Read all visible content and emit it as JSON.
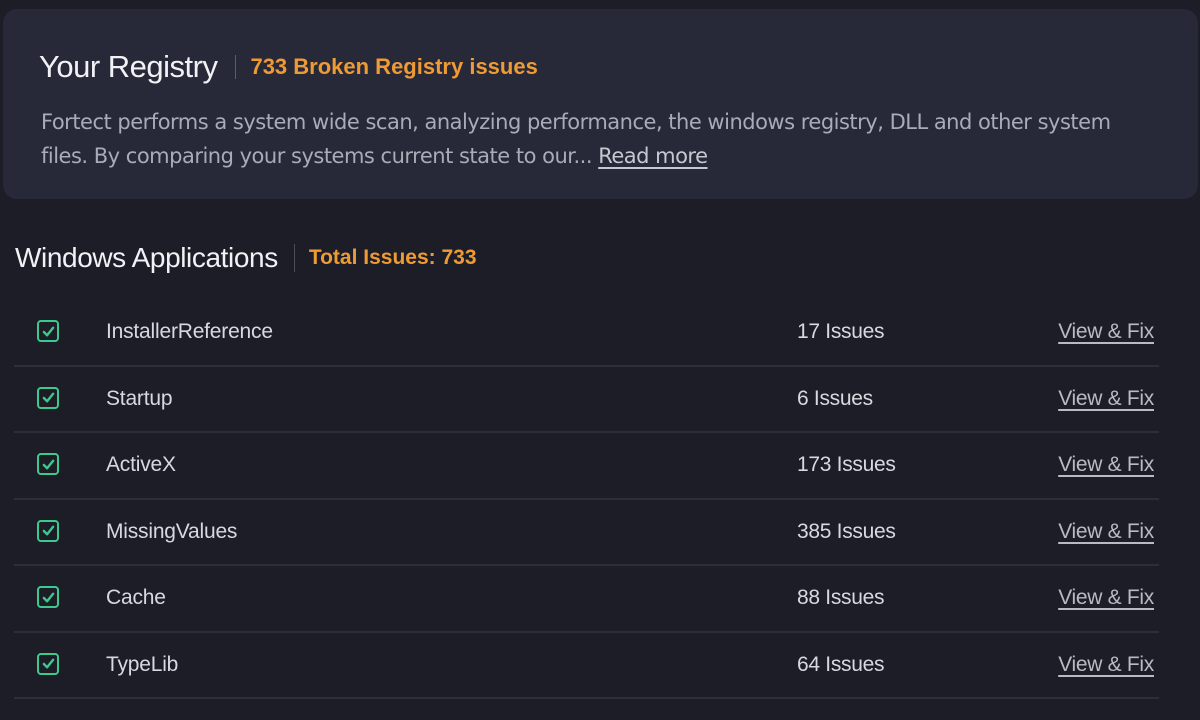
{
  "registry_card": {
    "title": "Your Registry",
    "subtitle": "733 Broken Registry issues",
    "description": "Fortect performs a system wide scan, analyzing performance, the windows registry, DLL and other system files. By comparing your systems current state to our...",
    "read_more_label": "Read more"
  },
  "section": {
    "title": "Windows Applications",
    "total_label": "Total Issues: 733"
  },
  "items": [
    {
      "name": "InstallerReference",
      "issues": "17 Issues",
      "action": "View & Fix",
      "checked": true
    },
    {
      "name": "Startup",
      "issues": "6 Issues",
      "action": "View & Fix",
      "checked": true
    },
    {
      "name": "ActiveX",
      "issues": "173 Issues",
      "action": "View & Fix",
      "checked": true
    },
    {
      "name": "MissingValues",
      "issues": "385 Issues",
      "action": "View & Fix",
      "checked": true
    },
    {
      "name": "Cache",
      "issues": "88 Issues",
      "action": "View & Fix",
      "checked": true
    },
    {
      "name": "TypeLib",
      "issues": "64 Issues",
      "action": "View & Fix",
      "checked": true
    }
  ],
  "colors": {
    "accent_orange": "#ee9a35",
    "check_green": "#3dc98c",
    "background": "#1c1d27",
    "card": "#272838"
  }
}
